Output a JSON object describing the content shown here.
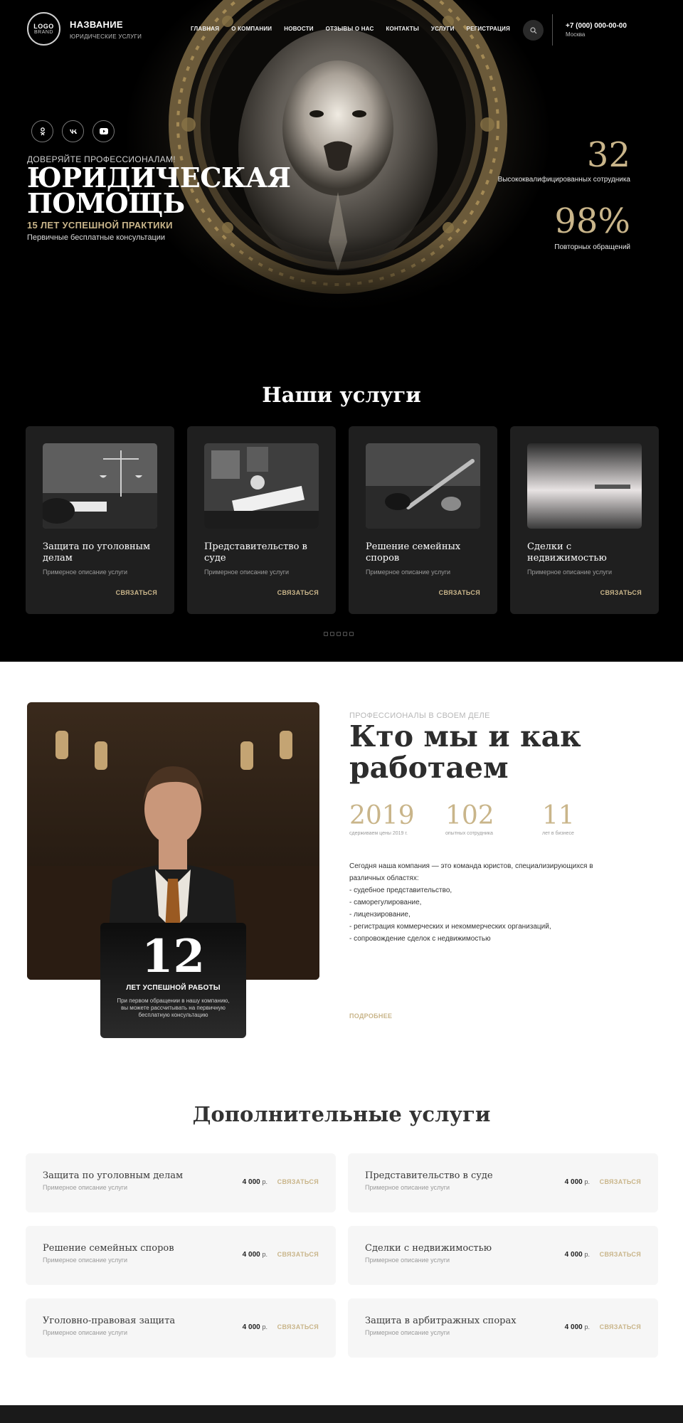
{
  "header": {
    "logo_line1": "LOGO",
    "logo_line2": "BRAND",
    "brand_name": "НАЗВАНИЕ",
    "brand_sub": "ЮРИДИЧЕСКИЕ УСЛУГИ",
    "nav": [
      "ГЛАВНАЯ",
      "О КОМПАНИИ",
      "НОВОСТИ",
      "ОТЗЫВЫ О НАС",
      "КОНТАКТЫ",
      "УСЛУГИ",
      "РЕГИСТРАЦИЯ"
    ],
    "phone": "+7 (000) 000-00-00",
    "city": "Москва"
  },
  "socials": [
    "ok",
    "vk",
    "youtube"
  ],
  "hero": {
    "pre": "ДОВЕРЯЙТЕ ПРОФЕССИОНАЛАМ!",
    "title": "ЮРИДИЧЕСКАЯ ПОМОЩЬ",
    "years": "15 ЛЕТ УСПЕШНОЙ ПРАКТИКИ",
    "consult": "Первичные бесплатные консультации",
    "stat1_value": "32",
    "stat1_label": "Высококвалифицированных сотрудника",
    "stat2_value": "98%",
    "stat2_label": "Повторных обращений"
  },
  "services": {
    "title": "Наши услуги",
    "items": [
      {
        "name": "Защита по уголовным делам",
        "desc": "Примерное описание услуги",
        "cta": "СВЯЗАТЬСЯ"
      },
      {
        "name": "Представительство в суде",
        "desc": "Примерное описание услуги",
        "cta": "СВЯЗАТЬСЯ"
      },
      {
        "name": "Решение семейных споров",
        "desc": "Примерное описание услуги",
        "cta": "СВЯЗАТЬСЯ"
      },
      {
        "name": "Сделки с недвижимостью",
        "desc": "Примерное описание услуги",
        "cta": "СВЯЗАТЬСЯ"
      }
    ]
  },
  "about": {
    "pre": "ПРОФЕССИОНАЛЫ В СВОЕМ ДЕЛЕ",
    "title": "Кто мы и как работаем",
    "stats": [
      {
        "value": "2019",
        "label": "сдерживаем цены 2019 г."
      },
      {
        "value": "102",
        "label": "опытных сотрудника"
      },
      {
        "value": "11",
        "label": "лет в бизнесе"
      }
    ],
    "text_lines": [
      "Сегодня наша компания — это команда юристов, специализирующихся в",
      "различных областях:",
      "- судебное представительство,",
      "- саморегулирование,",
      "- лицензирование,",
      "- регистрация коммерческих и некоммерческих организаций,",
      "- сопровождение сделок с недвижимостью"
    ],
    "more": "ПОДРОБНЕЕ",
    "exp_value": "12",
    "exp_label": "ЛЕТ УСПЕШНОЙ РАБОТЫ",
    "exp_text": "При первом обращении в нашу компанию, вы можете рассчитывать на первичную бесплатную консультацию"
  },
  "extra": {
    "title": "Дополнительные услуги",
    "currency": "р.",
    "items": [
      {
        "name": "Защита по уголовным делам",
        "desc": "Примерное описание услуги",
        "price": "4 000",
        "cta": "СВЯЗАТЬСЯ"
      },
      {
        "name": "Представительство в суде",
        "desc": "Примерное описание услуги",
        "price": "4 000",
        "cta": "СВЯЗАТЬСЯ"
      },
      {
        "name": "Решение семейных споров",
        "desc": "Примерное описание услуги",
        "price": "4 000",
        "cta": "СВЯЗАТЬСЯ"
      },
      {
        "name": "Сделки с недвижимостью",
        "desc": "Примерное описание услуги",
        "price": "4 000",
        "cta": "СВЯЗАТЬСЯ"
      },
      {
        "name": "Уголовно-правовая защита",
        "desc": "Примерное описание услуги",
        "price": "4 000",
        "cta": "СВЯЗАТЬСЯ"
      },
      {
        "name": "Защита в арбитражных спорах",
        "desc": "Примерное описание услуги",
        "price": "4 000",
        "cta": "СВЯЗАТЬСЯ"
      }
    ]
  },
  "colors": {
    "accent": "#c9b58a",
    "dark_card": "#1f1f1f",
    "light_card": "#f6f6f6"
  }
}
